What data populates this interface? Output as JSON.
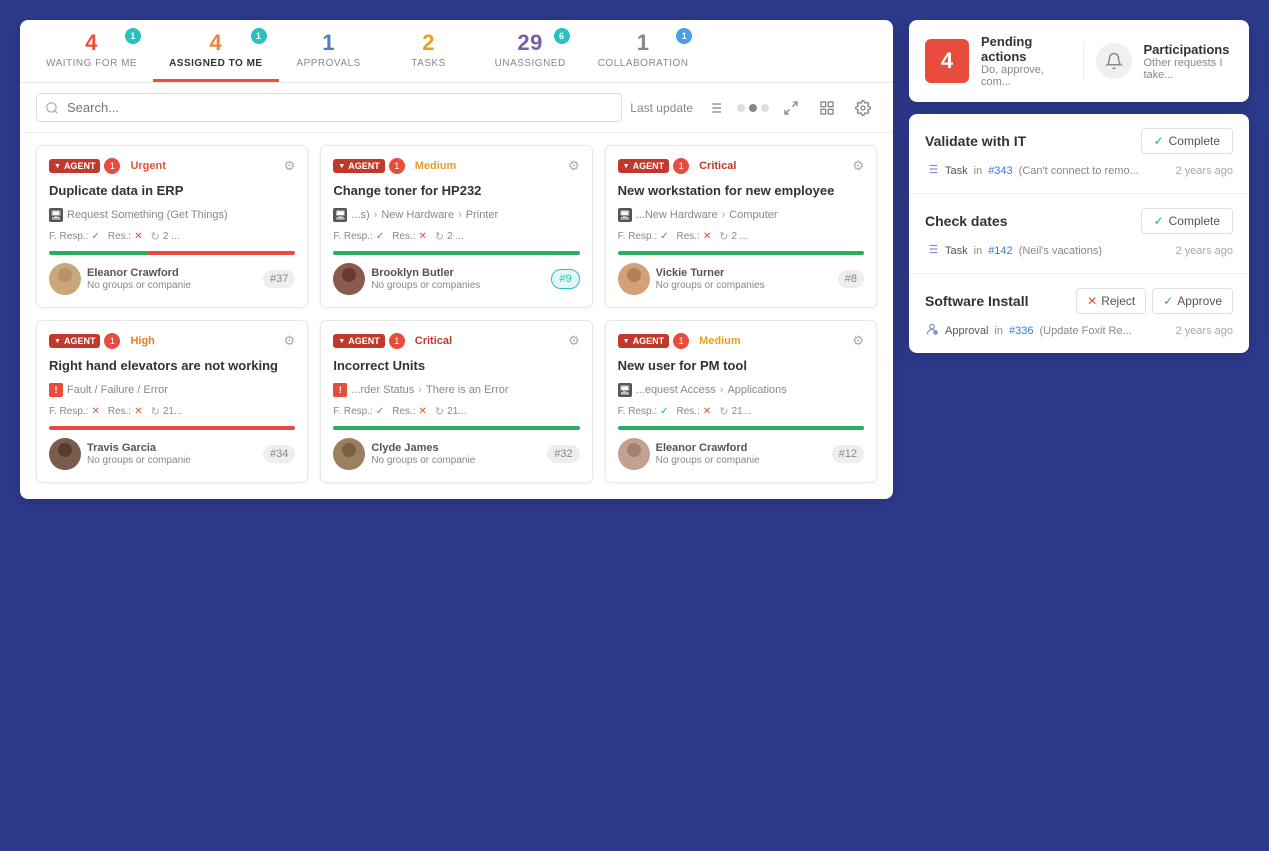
{
  "tabs": [
    {
      "id": "waiting",
      "count": "4",
      "count_color": "red",
      "label": "WAITING FOR ME",
      "badge": "1",
      "badge_color": "teal",
      "active": false
    },
    {
      "id": "assigned",
      "count": "4",
      "count_color": "orange",
      "label": "ASSIGNED TO ME",
      "badge": "1",
      "badge_color": "teal",
      "active": true
    },
    {
      "id": "approvals",
      "count": "1",
      "count_color": "blue",
      "label": "APPROVALS",
      "badge": null,
      "active": false
    },
    {
      "id": "tasks",
      "count": "2",
      "count_color": "yellow",
      "label": "TASKS",
      "badge": null,
      "active": false
    },
    {
      "id": "unassigned",
      "count": "29",
      "count_color": "purple",
      "label": "UNASSIGNED",
      "badge": "6",
      "badge_color": "teal",
      "active": false
    },
    {
      "id": "collab",
      "count": "1",
      "count_color": "gray",
      "label": "COLLABORATION",
      "badge": "1",
      "badge_color": "blue2",
      "active": false
    }
  ],
  "toolbar": {
    "search_placeholder": "Search...",
    "last_update_label": "Last update",
    "sort_icon": "⇅",
    "expand_icon": "⛶",
    "grid_icon": "⊞",
    "settings_icon": "⚙"
  },
  "cards": [
    {
      "id": "card1",
      "agent_label": "AGENT",
      "agent_count": "1",
      "priority": "Urgent",
      "priority_class": "priority-urgent",
      "title": "Duplicate data in ERP",
      "category_icon": "🖥",
      "category": "Request Something (Get Things)",
      "f_resp_status": "check",
      "res_status": "x",
      "cycle_count": "2 ...",
      "progress_class": "progress-red-partial",
      "assignee_name": "Eleanor Crawford",
      "assignee_sub": "No groups or companie",
      "ticket": "#37",
      "ticket_class": ""
    },
    {
      "id": "card2",
      "agent_label": "AGENT",
      "agent_count": "1",
      "priority": "Medium",
      "priority_class": "priority-medium",
      "title": "Change toner for HP232",
      "category_icon": "🖥",
      "category_parts": [
        "...s)",
        "New Hardware",
        "Printer"
      ],
      "f_resp_status": "check",
      "res_status": "x",
      "cycle_count": "2 ...",
      "progress_class": "progress-green",
      "assignee_name": "Brooklyn Butler",
      "assignee_sub": "No groups or companies",
      "ticket": "#9",
      "ticket_class": "teal-outline"
    },
    {
      "id": "card3",
      "agent_label": "AGENT",
      "agent_count": "1",
      "priority": "Critical",
      "priority_class": "priority-critical",
      "title": "New workstation for new employee",
      "category_icon": "🖥",
      "category_parts": [
        "...New Hardware",
        "Computer"
      ],
      "f_resp_status": "check",
      "res_status": "x",
      "cycle_count": "2 ...",
      "progress_class": "progress-green",
      "assignee_name": "Vickie Turner",
      "assignee_sub": "No groups or companies",
      "ticket": "#8",
      "ticket_class": ""
    },
    {
      "id": "card4",
      "agent_label": "AGENT",
      "agent_count": "1",
      "priority": "High",
      "priority_class": "priority-high",
      "title": "Right hand elevators are not working",
      "category_icon": "!",
      "category": "Fault / Failure / Error",
      "f_resp_status": "x",
      "res_status": "x",
      "cycle_count": "21...",
      "progress_class": "progress-red",
      "assignee_name": "Travis Garcia",
      "assignee_sub": "No groups or companie",
      "ticket": "#34",
      "ticket_class": ""
    },
    {
      "id": "card5",
      "agent_label": "AGENT",
      "agent_count": "1",
      "priority": "Critical",
      "priority_class": "priority-critical",
      "title": "Incorrect Units",
      "category_icon": "!",
      "category_parts": [
        "...rder Status",
        "There is an Error"
      ],
      "f_resp_status": "check",
      "res_status": "x",
      "cycle_count": "21...",
      "progress_class": "progress-green",
      "assignee_name": "Clyde James",
      "assignee_sub": "No groups or companie",
      "ticket": "#32",
      "ticket_class": ""
    },
    {
      "id": "card6",
      "agent_label": "AGENT",
      "agent_count": "1",
      "priority": "Medium",
      "priority_class": "priority-medium",
      "title": "New user for PM tool",
      "category_icon": "🖥",
      "category_parts": [
        "...equest Access",
        "Applications"
      ],
      "f_resp_status": "check",
      "res_status": "x",
      "cycle_count": "21...",
      "progress_class": "progress-green",
      "assignee_name": "Eleanor Crawford",
      "assignee_sub": "No groups or companie",
      "ticket": "#12",
      "ticket_class": ""
    }
  ],
  "right_panel": {
    "pending_count": "4",
    "pending_title": "Pending actions",
    "pending_sub": "Do, approve, com...",
    "particip_title": "Participations",
    "particip_sub": "Other requests I take...",
    "actions": [
      {
        "id": "action1",
        "title": "Validate with IT",
        "btn_type": "complete",
        "btn_label": "Complete",
        "meta_type": "task",
        "meta_prefix": "Task",
        "meta_in": "in",
        "meta_ref": "#343",
        "meta_desc": "(Can't connect to remo...",
        "meta_time": "2 years ago"
      },
      {
        "id": "action2",
        "title": "Check dates",
        "btn_type": "complete",
        "btn_label": "Complete",
        "meta_type": "task",
        "meta_prefix": "Task",
        "meta_in": "in",
        "meta_ref": "#142",
        "meta_desc": "(Neil's vacations)",
        "meta_time": "2 years ago"
      },
      {
        "id": "action3",
        "title": "Software Install",
        "btn_type": "reject_approve",
        "reject_label": "Reject",
        "approve_label": "Approve",
        "meta_type": "approval",
        "meta_prefix": "Approval",
        "meta_in": "in",
        "meta_ref": "#336",
        "meta_desc": "(Update Foxit Re...",
        "meta_time": "2 years ago"
      }
    ]
  }
}
